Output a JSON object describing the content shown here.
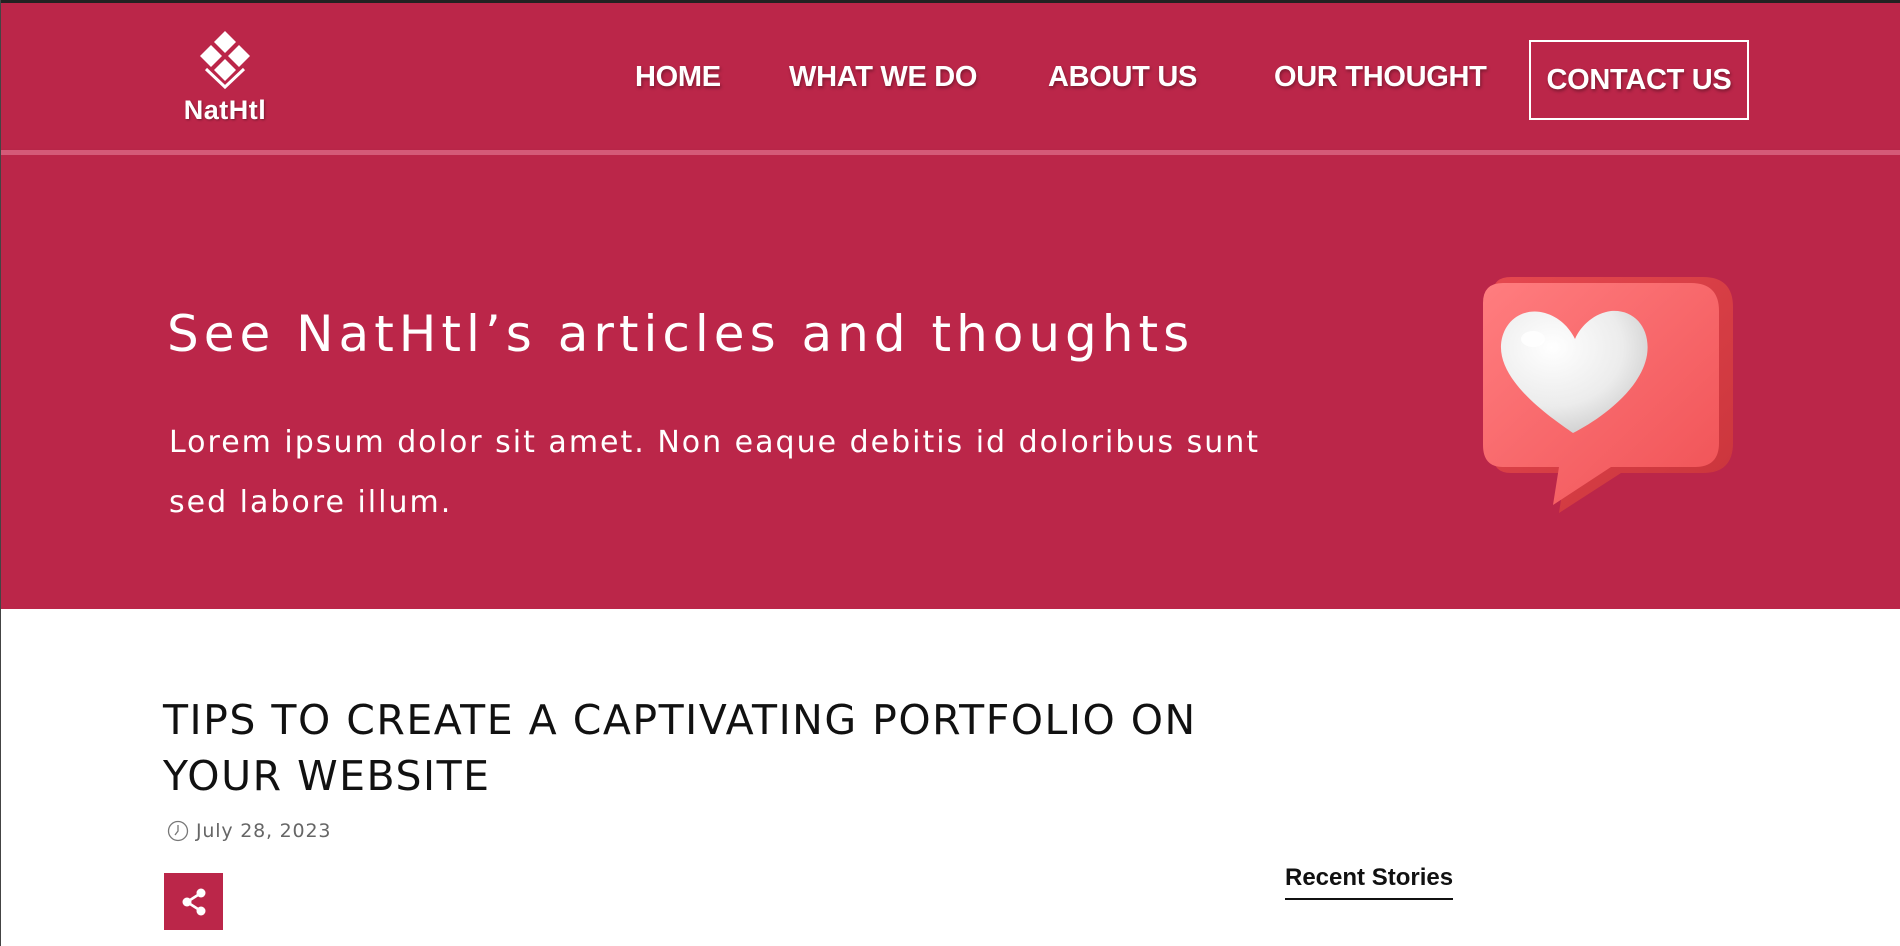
{
  "header": {
    "logo_text": "NatHtl",
    "nav": {
      "home": "HOME",
      "what_we_do": "WHAT WE DO",
      "about_us": "ABOUT US",
      "our_thought": "OUR THOUGHT",
      "contact_us": "CONTACT US"
    }
  },
  "hero": {
    "title": "See NatHtl’s articles and thoughts",
    "text": "Lorem ipsum dolor sit amet. Non eaque debitis id doloribus sunt sed labore illum."
  },
  "article": {
    "title": "TIPS TO CREATE A CAPTIVATING PORTFOLIO ON YOUR WEBSITE",
    "date": "July 28, 2023"
  },
  "sidebar": {
    "heading": "Recent Stories"
  },
  "icons": {
    "logo": "diamond-logo-icon",
    "hero_art": "heart-speech-bubble-icon",
    "date": "clock-icon",
    "share": "share-icon"
  },
  "colors": {
    "brand": "#bb2649",
    "text_on_brand": "#ffffff",
    "heading": "#111111",
    "meta": "#666666"
  }
}
